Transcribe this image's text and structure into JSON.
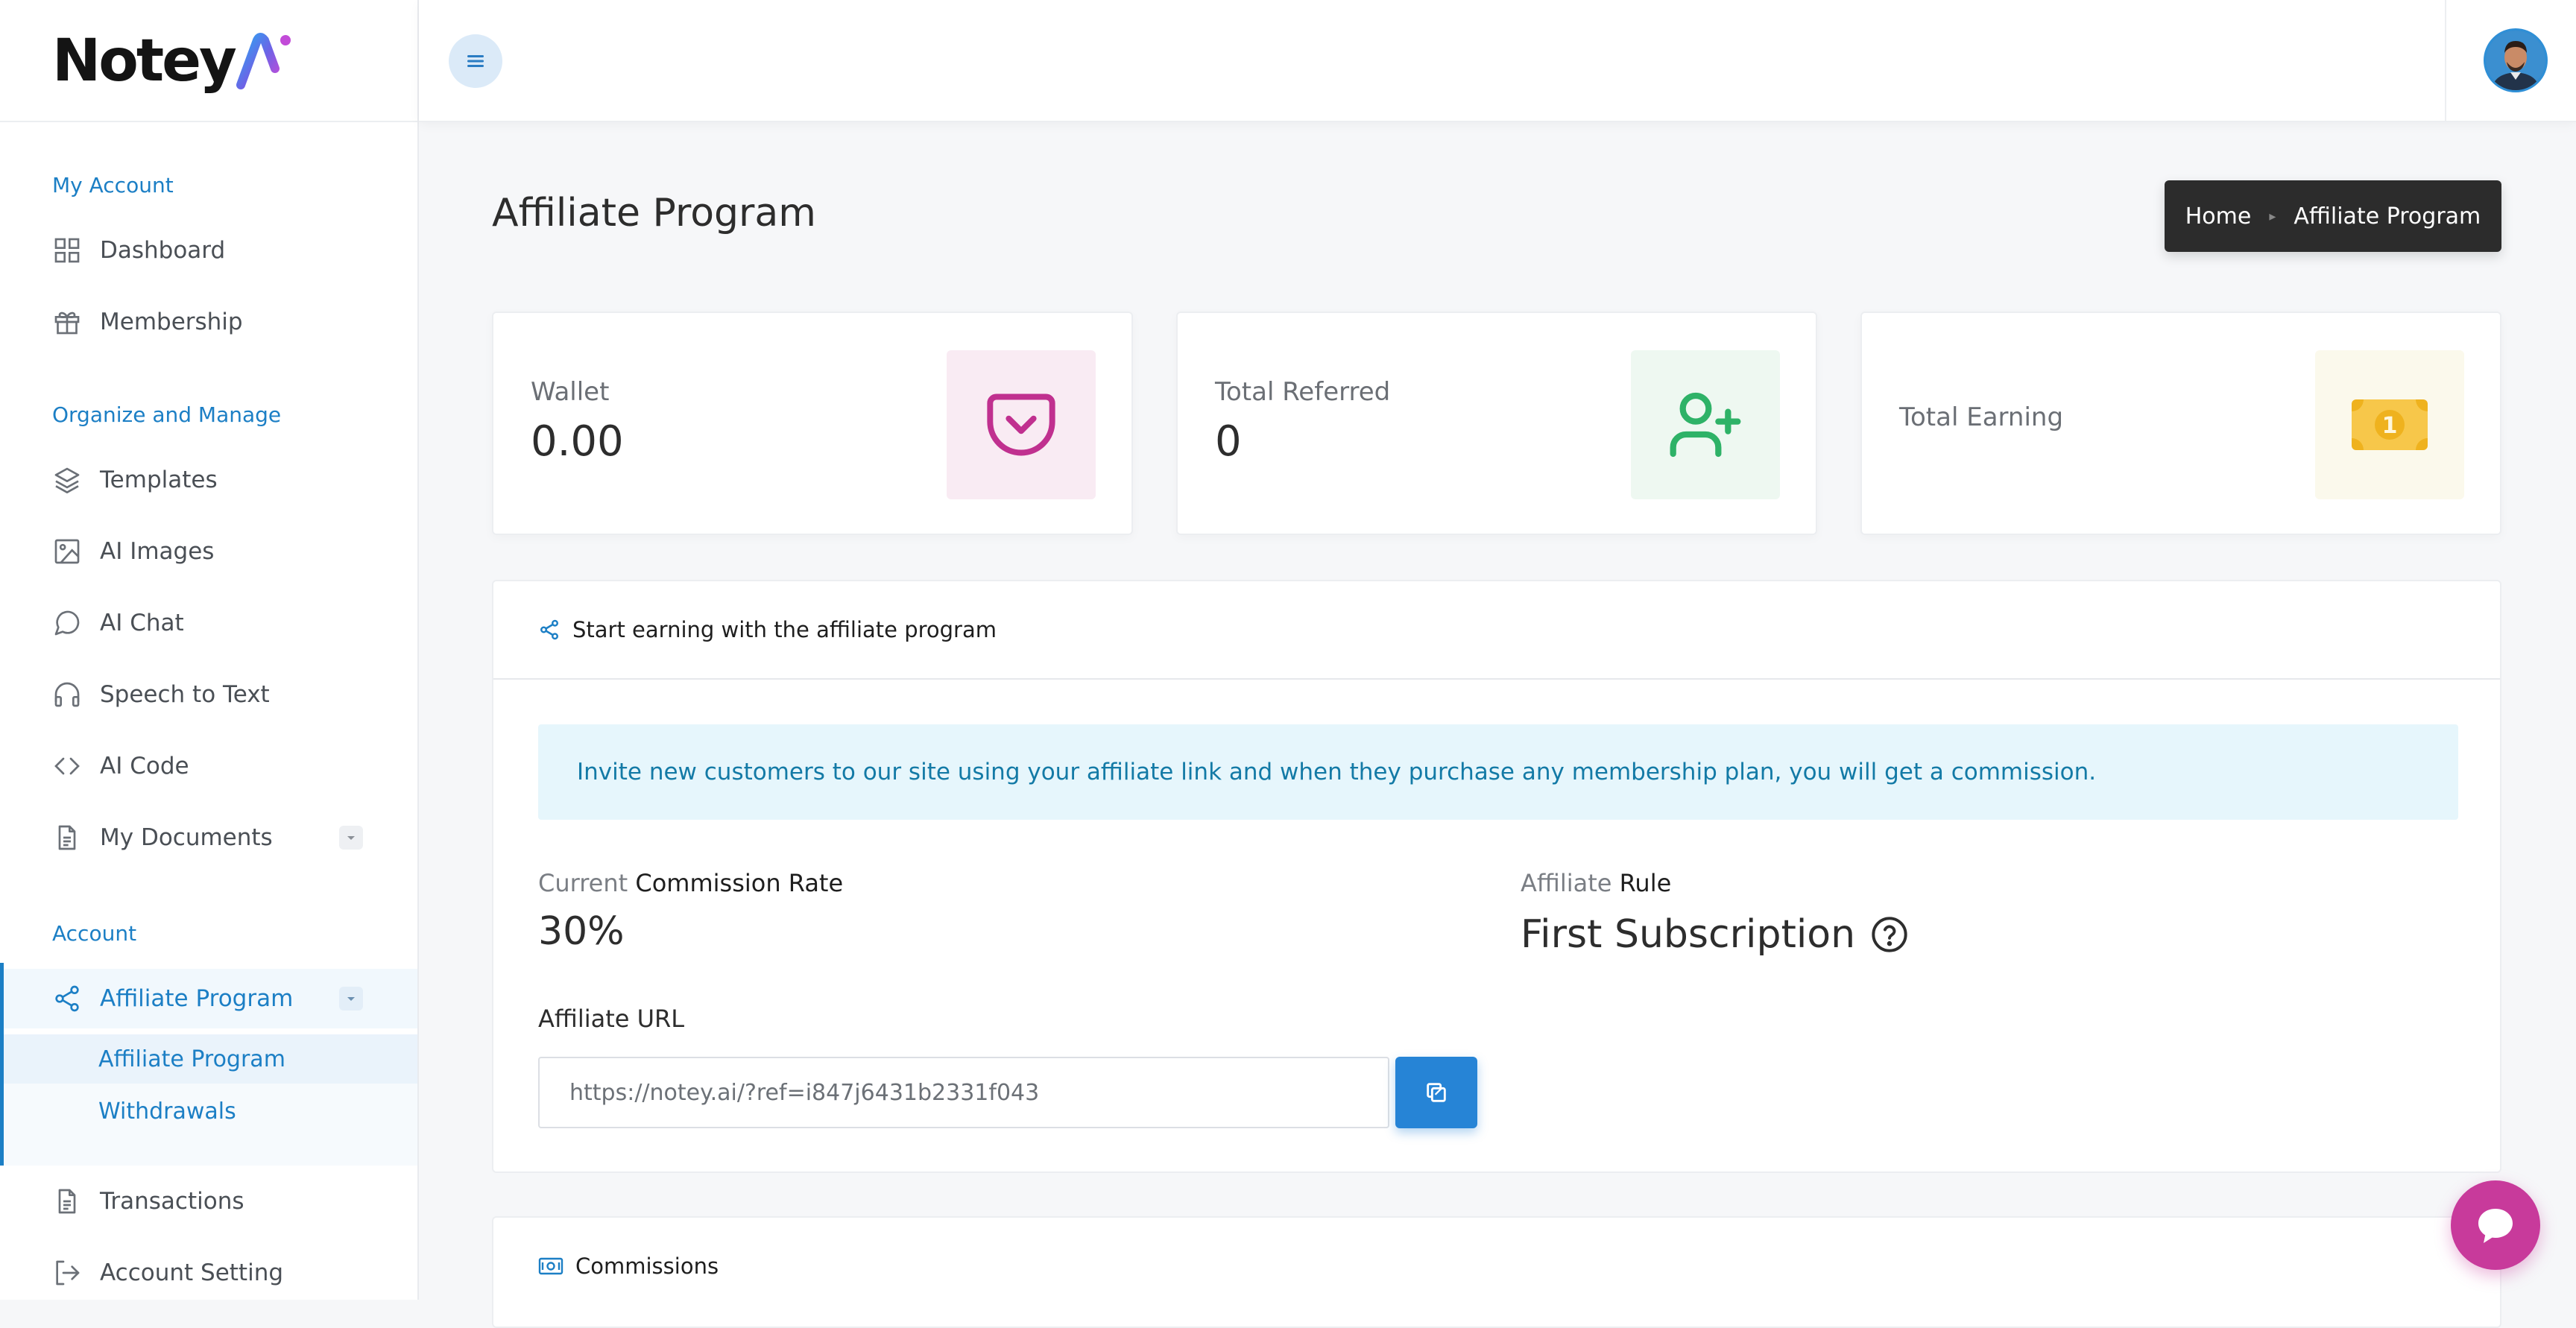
{
  "app": {
    "logo_text": "Notey",
    "logo_suffix": "Ai"
  },
  "sidebar": {
    "sections": [
      {
        "label": "My Account"
      },
      {
        "label": "Organize and Manage"
      },
      {
        "label": "Account"
      }
    ],
    "items": [
      {
        "label": "Dashboard",
        "icon": "grid-icon"
      },
      {
        "label": "Membership",
        "icon": "gift-icon"
      },
      {
        "label": "Templates",
        "icon": "layers-icon"
      },
      {
        "label": "AI Images",
        "icon": "image-icon"
      },
      {
        "label": "AI Chat",
        "icon": "chat-icon"
      },
      {
        "label": "Speech to Text",
        "icon": "headphones-icon"
      },
      {
        "label": "AI Code",
        "icon": "code-icon"
      },
      {
        "label": "My Documents",
        "icon": "document-icon"
      },
      {
        "label": "Affiliate Program",
        "icon": "share-icon"
      },
      {
        "label": "Transactions",
        "icon": "document-icon"
      },
      {
        "label": "Account Setting",
        "icon": "logout-icon"
      }
    ],
    "sub_items": [
      {
        "label": "Affiliate Program"
      },
      {
        "label": "Withdrawals"
      }
    ]
  },
  "page": {
    "title": "Affiliate Program",
    "breadcrumb": {
      "home": "Home",
      "current": "Affiliate Program"
    }
  },
  "stats": [
    {
      "label": "Wallet",
      "value": "0.00",
      "icon": "pocket-icon",
      "color": "#c0308f",
      "bg": "#f9ebf3"
    },
    {
      "label": "Total Referred",
      "value": "0",
      "icon": "user-plus-icon",
      "color": "#2eb267",
      "bg": "#eef8f1"
    },
    {
      "label": "Total Earning",
      "value": "",
      "icon": "money-icon",
      "color": "#efb21e",
      "bg": "#fbf9ec"
    }
  ],
  "affiliate": {
    "header": "Start earning with the affiliate program",
    "info": "Invite new customers to our site using your affiliate link and when they purchase any membership plan, you will get a commission.",
    "commission_prefix": "Current",
    "commission_label": "Commission Rate",
    "commission_value": "30%",
    "rule_prefix": "Affiliate",
    "rule_label": "Rule",
    "rule_value": "First Subscription",
    "url_label": "Affiliate URL",
    "url_value": "https://notey.ai/?ref=i847j6431b2331f043"
  },
  "commissions": {
    "header": "Commissions"
  },
  "colors": {
    "accent": "#1c7fc5",
    "chat": "#c83a9b"
  }
}
